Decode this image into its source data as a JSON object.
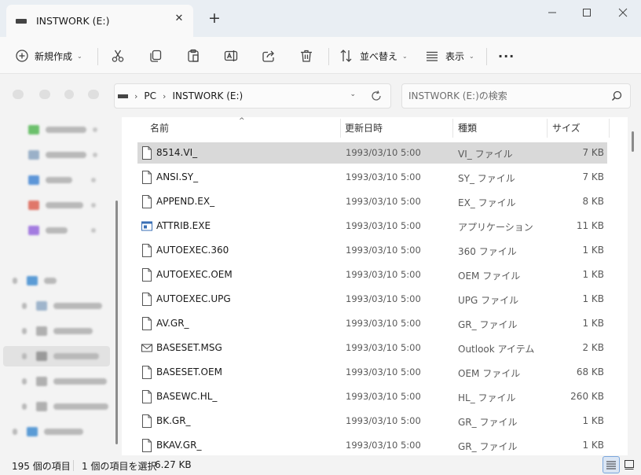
{
  "window": {
    "tab_title": "INSTWORK (E:)",
    "new_tab_glyph": "+",
    "close_glyph": "✕"
  },
  "toolbar": {
    "new_label": "新規作成",
    "sort_label": "並べ替え",
    "view_label": "表示",
    "more_label": "···"
  },
  "address": {
    "crumbs": [
      "PC",
      "INSTWORK (E:)"
    ]
  },
  "search": {
    "placeholder": "INSTWORK (E:)の検索"
  },
  "columns": {
    "name": "名前",
    "date": "更新日時",
    "type": "種類",
    "size": "サイズ"
  },
  "files": [
    {
      "name": "8514.VI_",
      "date": "1993/03/10 5:00",
      "type": "VI_ ファイル",
      "size": "7 KB",
      "icon": "file-icon",
      "selected": true
    },
    {
      "name": "ANSI.SY_",
      "date": "1993/03/10 5:00",
      "type": "SY_ ファイル",
      "size": "7 KB",
      "icon": "file-icon"
    },
    {
      "name": "APPEND.EX_",
      "date": "1993/03/10 5:00",
      "type": "EX_ ファイル",
      "size": "8 KB",
      "icon": "file-icon"
    },
    {
      "name": "ATTRIB.EXE",
      "date": "1993/03/10 5:00",
      "type": "アプリケーション",
      "size": "11 KB",
      "icon": "app-icon"
    },
    {
      "name": "AUTOEXEC.360",
      "date": "1993/03/10 5:00",
      "type": "360 ファイル",
      "size": "1 KB",
      "icon": "file-icon"
    },
    {
      "name": "AUTOEXEC.OEM",
      "date": "1993/03/10 5:00",
      "type": "OEM ファイル",
      "size": "1 KB",
      "icon": "file-icon"
    },
    {
      "name": "AUTOEXEC.UPG",
      "date": "1993/03/10 5:00",
      "type": "UPG ファイル",
      "size": "1 KB",
      "icon": "file-icon"
    },
    {
      "name": "AV.GR_",
      "date": "1993/03/10 5:00",
      "type": "GR_ ファイル",
      "size": "1 KB",
      "icon": "file-icon"
    },
    {
      "name": "BASESET.MSG",
      "date": "1993/03/10 5:00",
      "type": "Outlook アイテム",
      "size": "2 KB",
      "icon": "mail-icon"
    },
    {
      "name": "BASESET.OEM",
      "date": "1993/03/10 5:00",
      "type": "OEM ファイル",
      "size": "68 KB",
      "icon": "file-icon"
    },
    {
      "name": "BASEWC.HL_",
      "date": "1993/03/10 5:00",
      "type": "HL_ ファイル",
      "size": "260 KB",
      "icon": "file-icon"
    },
    {
      "name": "BK.GR_",
      "date": "1993/03/10 5:00",
      "type": "GR_ ファイル",
      "size": "1 KB",
      "icon": "file-icon"
    },
    {
      "name": "BKAV.GR_",
      "date": "1993/03/10 5:00",
      "type": "GR_ ファイル",
      "size": "1 KB",
      "icon": "file-icon"
    }
  ],
  "status": {
    "count": "195 個の項目",
    "selection": "1 個の項目を選択",
    "selection_size": "6.27 KB"
  },
  "colors": {
    "accent": "#0067c0",
    "selected_row": "#d9d9d9"
  }
}
